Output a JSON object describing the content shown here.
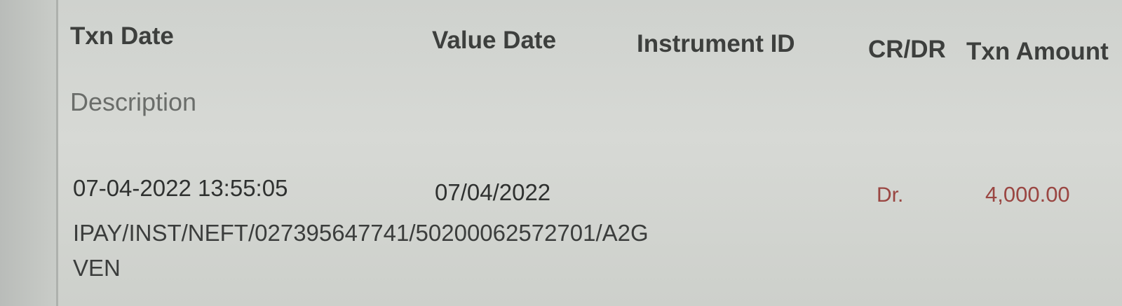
{
  "columns": {
    "txn_date": "Txn Date",
    "value_date": "Value Date",
    "instrument_id": "Instrument ID",
    "cr_dr": "CR/DR",
    "txn_amount": "Txn Amount",
    "description": "Description"
  },
  "rows": [
    {
      "txn_date": "07-04-2022 13:55:05",
      "value_date": "07/04/2022",
      "instrument_id": "",
      "cr_dr": "Dr.",
      "txn_amount": "4,000.00",
      "description_line1": "IPAY/INST/NEFT/027395647741/50200062572701/A2G",
      "description_line2": "VEN"
    }
  ],
  "colors": {
    "debit": "#9a4642",
    "header_text": "#3d3f3d",
    "background": "#d4d6d2"
  }
}
